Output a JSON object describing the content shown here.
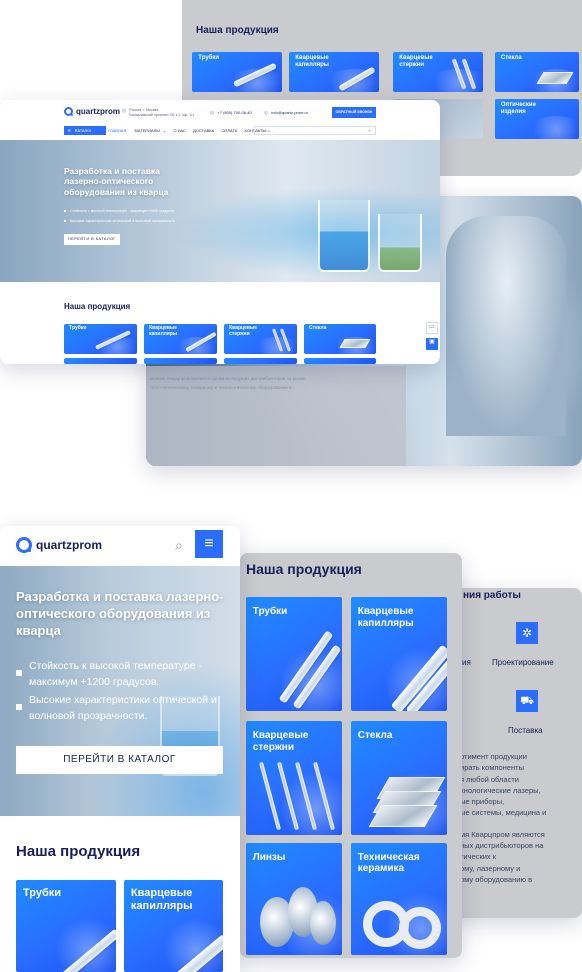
{
  "brand": {
    "name": "quartzprom",
    "accent": "#2a6dff",
    "dark": "#16205a"
  },
  "desktop": {
    "contacts": {
      "address": "Россия, г. Москва,\nБалаклавский проспект 28, к.1, оф. 1/1",
      "phone": "+7 (800) 700-06-40",
      "email": "info@quartz-prom.ru",
      "callback": "ОБРАТНЫЙ ЗВОНОК"
    },
    "catalog_button": "Каталог",
    "nav": [
      "ГЛАВНАЯ",
      "МАТЕРИАЛЫ",
      "О НАС",
      "ДОСТАВКА",
      "ОПЛАТА",
      "КОНТАКТЫ"
    ],
    "search_placeholder": "Поиск...",
    "hero": {
      "title": "Разработка и поставка лазерно-оптического оборудования из кварца",
      "bullets": [
        "Стойкость к высокой температуре - максимум +1200 градусов.",
        "Высокие характеристики оптической и волновой прозрачности."
      ],
      "button": "ПЕРЕЙТИ В КАТАЛОГ"
    },
    "products_title": "Наша продукция",
    "tiles": [
      "Трубки",
      "Кварцевые\nкапилляры",
      "Кварцевые\nстержни",
      "Стекла"
    ]
  },
  "back_top": {
    "products_title": "Наша продукция",
    "tiles": [
      "Трубки",
      "Кварцевые\nкапилляры",
      "Кварцевые\nстержни",
      "Стекла",
      "Оптические\nизделия"
    ]
  },
  "back_about": {
    "text_lines": [
      "мпания Кварцпром является одним из ведущих дистрибьюторов на рынке",
      "ткого-оптическому, лазерному и технологическому оборудованию в"
    ]
  },
  "mobile": {
    "hero": {
      "title": "Разработка и поставка лазерно-оптического оборудования из кварца",
      "bullets": [
        "Стойкость к высокой температуре - максимум +1200 градусов.",
        "Высокие характеристики оптической и волновой прозрачности."
      ],
      "button": "ПЕРЕЙТИ В КАТАЛОГ"
    },
    "products_title": "Наша продукция",
    "tiles": [
      "Трубки",
      "Кварцевые\nкапилляры"
    ]
  },
  "tablet_products": {
    "title": "Наша продукция",
    "tiles": [
      "Трубки",
      "Кварцевые\nкапилляры",
      "Кварцевые\nстержни",
      "Стекла",
      "Линзы",
      "Техническая\nкерамика"
    ]
  },
  "tablet_work": {
    "title": "ния работы",
    "items": [
      "ия",
      "Проектирование",
      "Поставка"
    ],
    "text_lines": [
      "ртимент продукции",
      "ирать компоненты",
      "я любой области",
      "хнологические лазеры,",
      "ые приборы,",
      "ые системы, медицина и",
      "мя Кварцпром являются",
      "ных дистрибьюторов на",
      "тических к",
      "ому, лазерному и",
      "ому оборудованию в"
    ]
  }
}
